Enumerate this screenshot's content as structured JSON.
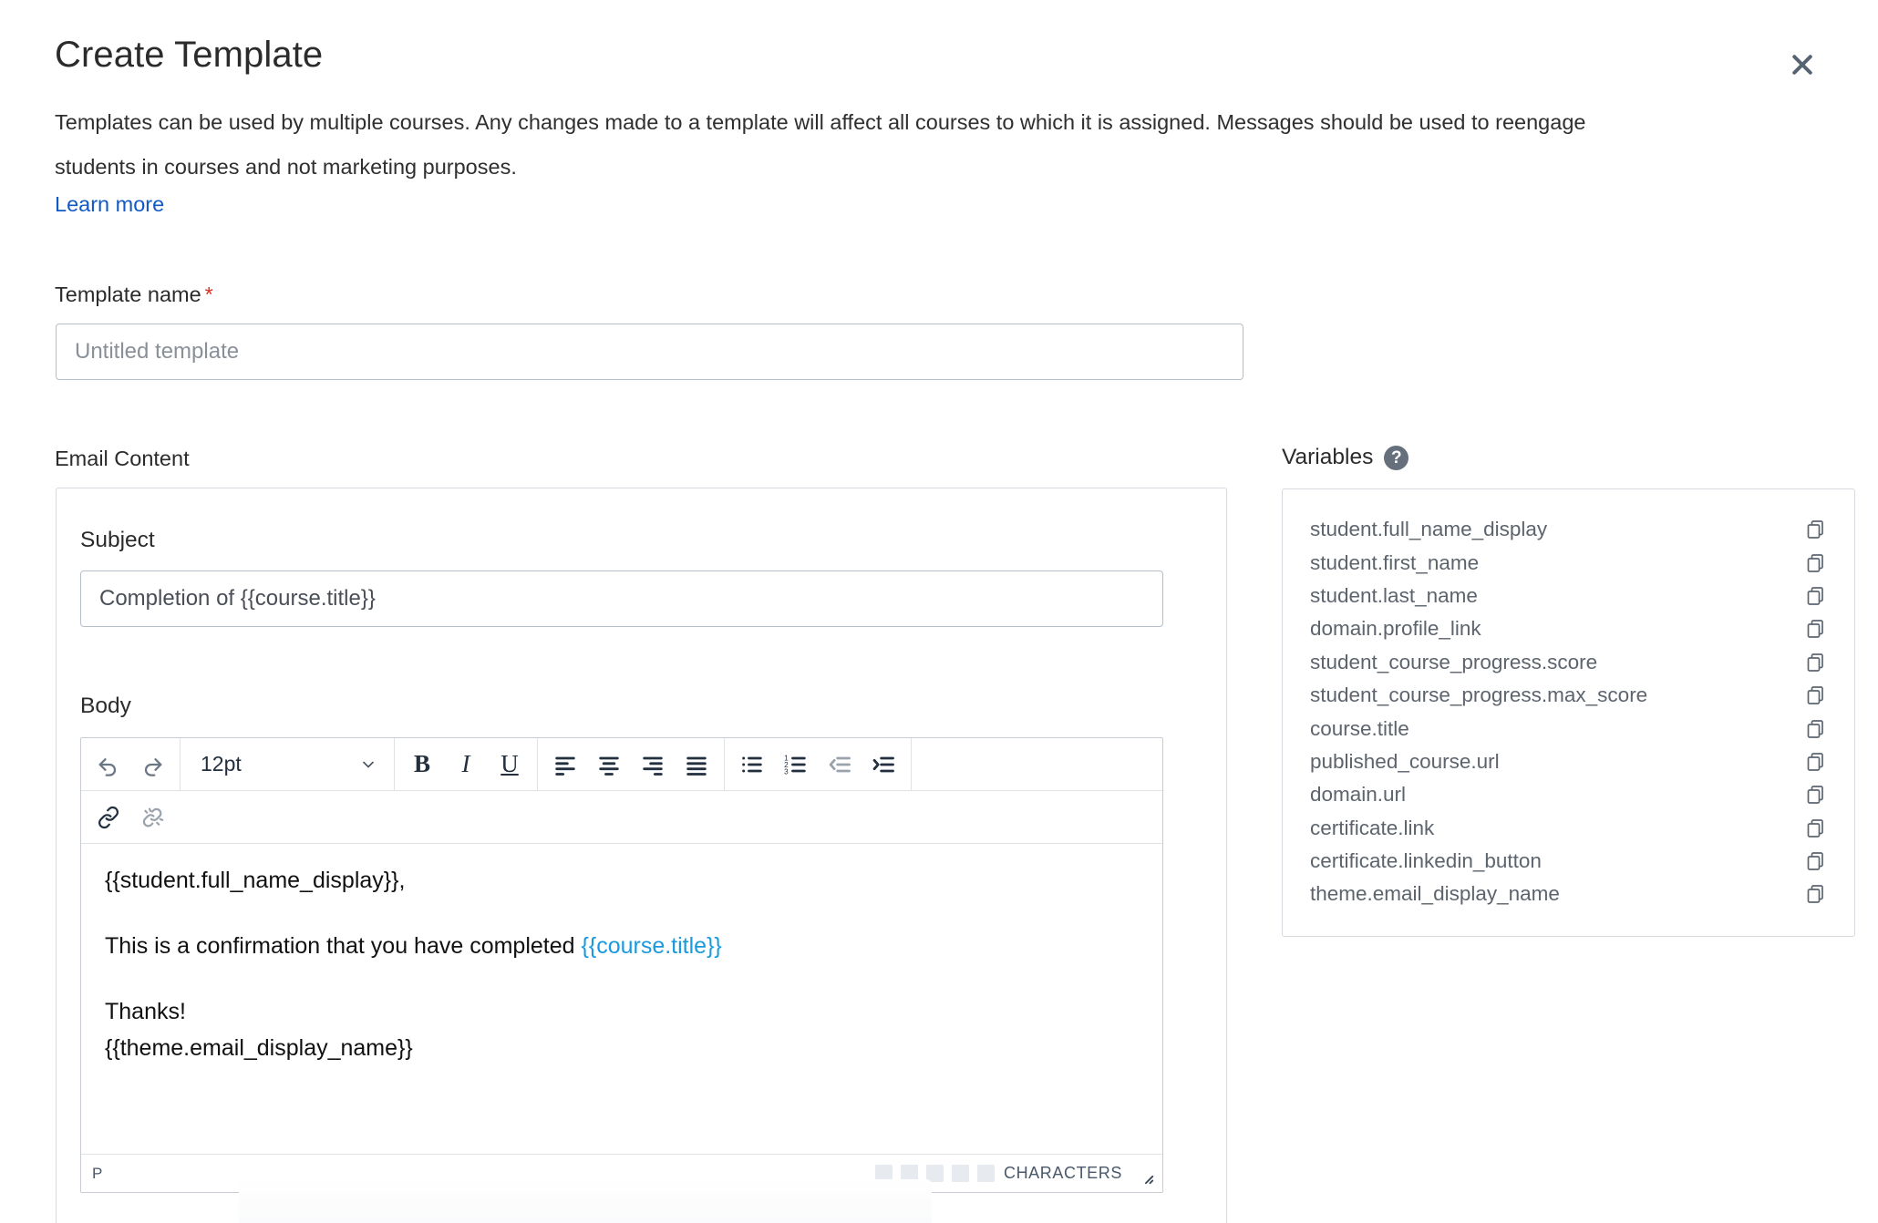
{
  "dialog": {
    "title": "Create Template",
    "description": "Templates can be used by multiple courses. Any changes made to a template will affect all courses to which it is assigned. Messages should be used to reengage students in courses and not marketing purposes.",
    "learn_more": "Learn more",
    "close_icon": "close-icon"
  },
  "template_name": {
    "label": "Template name",
    "required_marker": "*",
    "placeholder": "Untitled template",
    "value": ""
  },
  "email_content": {
    "label": "Email Content",
    "subject": {
      "label": "Subject",
      "value": "Completion of {{course.title}}",
      "placeholder": ""
    },
    "body": {
      "label": "Body",
      "toolbar": {
        "undo": "undo-icon",
        "redo": "redo-icon",
        "fontsize_value": "12pt",
        "bold": "B",
        "italic": "I",
        "underline": "U",
        "align_left": "align-left-icon",
        "align_center": "align-center-icon",
        "align_right": "align-right-icon",
        "align_justify": "align-justify-icon",
        "bullet_list": "bullet-list-icon",
        "numbered_list": "numbered-list-icon",
        "outdent": "outdent-icon",
        "indent": "indent-icon",
        "link": "link-icon",
        "unlink": "unlink-icon"
      },
      "lines": {
        "greeting": "{{student.full_name_display}},",
        "confirmation_prefix": "This is a confirmation that you have completed ",
        "confirmation_variable": "{{course.title}}",
        "thanks": "Thanks!",
        "signature": "{{theme.email_display_name}}"
      },
      "status": {
        "path": "P",
        "characters_label": "CHARACTERS",
        "skeleton_blocks": 5
      }
    }
  },
  "variables": {
    "heading": "Variables",
    "help_icon": "help-icon",
    "items": [
      {
        "name": "student.full_name_display",
        "copy_icon": "copy-icon"
      },
      {
        "name": "student.first_name",
        "copy_icon": "copy-icon"
      },
      {
        "name": "student.last_name",
        "copy_icon": "copy-icon"
      },
      {
        "name": "domain.profile_link",
        "copy_icon": "copy-icon"
      },
      {
        "name": "student_course_progress.score",
        "copy_icon": "copy-icon"
      },
      {
        "name": "student_course_progress.max_score",
        "copy_icon": "copy-icon"
      },
      {
        "name": "course.title",
        "copy_icon": "copy-icon"
      },
      {
        "name": "published_course.url",
        "copy_icon": "copy-icon"
      },
      {
        "name": "domain.url",
        "copy_icon": "copy-icon"
      },
      {
        "name": "certificate.link",
        "copy_icon": "copy-icon"
      },
      {
        "name": "certificate.linkedin_button",
        "copy_icon": "copy-icon"
      },
      {
        "name": "theme.email_display_name",
        "copy_icon": "copy-icon"
      }
    ]
  },
  "colors": {
    "link_blue": "#1159c4",
    "variable_highlight": "#1a9ade",
    "required_red": "#d93025",
    "icon_slate": "#566372",
    "help_gray": "#66707c",
    "border_gray": "#d6dade"
  }
}
